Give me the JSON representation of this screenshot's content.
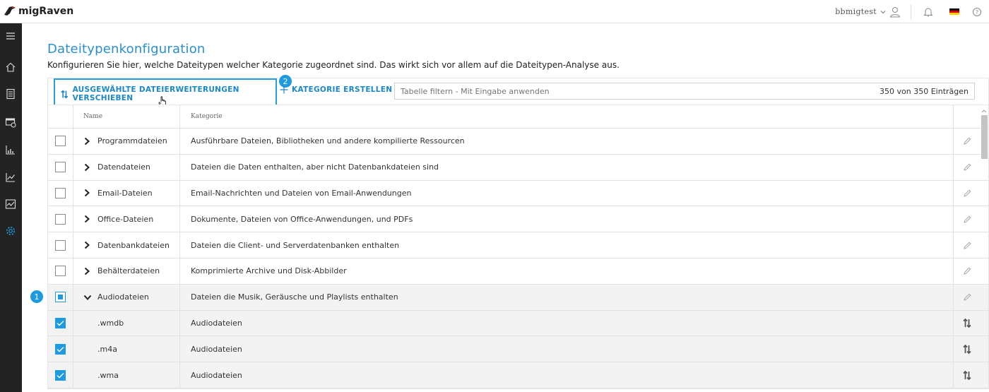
{
  "app": {
    "name": "migRaven"
  },
  "header": {
    "username": "bbmigtest",
    "language_flag": "de-flag"
  },
  "page": {
    "title": "Dateitypenkonfiguration",
    "description": "Konfigurieren Sie hier, welche Dateitypen welcher Kategorie zugeordnet sind. Das wirkt sich vor allem auf die Dateitypen-Analyse aus."
  },
  "toolbar": {
    "move_label": "AUSGEWÄHLTE DATEIERWEITERUNGEN VERSCHIEBEN",
    "create_label": "KATEGORIE ERSTELLEN",
    "filter_placeholder": "Tabelle filtern - Mit Eingabe anwenden",
    "count": "350 von 350 Einträgen"
  },
  "badges": {
    "one": "1",
    "two": "2"
  },
  "table": {
    "columns": {
      "name": "Name",
      "category": "Kategorie"
    },
    "rows": [
      {
        "name": "Programmdateien",
        "category": "Ausführbare Dateien, Bibliotheken und andere kompilierte Ressourcen",
        "kind": "group",
        "expanded": false,
        "checked": "none"
      },
      {
        "name": "Datendateien",
        "category": "Dateien die Daten enthalten, aber nicht Datenbankdateien sind",
        "kind": "group",
        "expanded": false,
        "checked": "none"
      },
      {
        "name": "Email-Dateien",
        "category": "Email-Nachrichten und Dateien von Email-Anwendungen",
        "kind": "group",
        "expanded": false,
        "checked": "none"
      },
      {
        "name": "Office-Dateien",
        "category": "Dokumente, Dateien von Office-Anwendungen, und PDFs",
        "kind": "group",
        "expanded": false,
        "checked": "none"
      },
      {
        "name": "Datenbankdateien",
        "category": "Dateien die Client- und Serverdatenbanken enthalten",
        "kind": "group",
        "expanded": false,
        "checked": "none"
      },
      {
        "name": "Behälterdateien",
        "category": "Komprimierte Archive und Disk-Abbilder",
        "kind": "group",
        "expanded": false,
        "checked": "none"
      },
      {
        "name": "Audiodateien",
        "category": "Dateien die Musik, Geräusche und Playlists enthalten",
        "kind": "group",
        "expanded": true,
        "checked": "partial"
      },
      {
        "name": ".wmdb",
        "category": "Audiodateien",
        "kind": "ext",
        "checked": "checked"
      },
      {
        "name": ".m4a",
        "category": "Audiodateien",
        "kind": "ext",
        "checked": "checked"
      },
      {
        "name": ".wma",
        "category": "Audiodateien",
        "kind": "ext",
        "checked": "checked"
      }
    ]
  },
  "colors": {
    "accent": "#1e9be0",
    "sidebar": "#232323",
    "title": "#2a8fcf"
  }
}
